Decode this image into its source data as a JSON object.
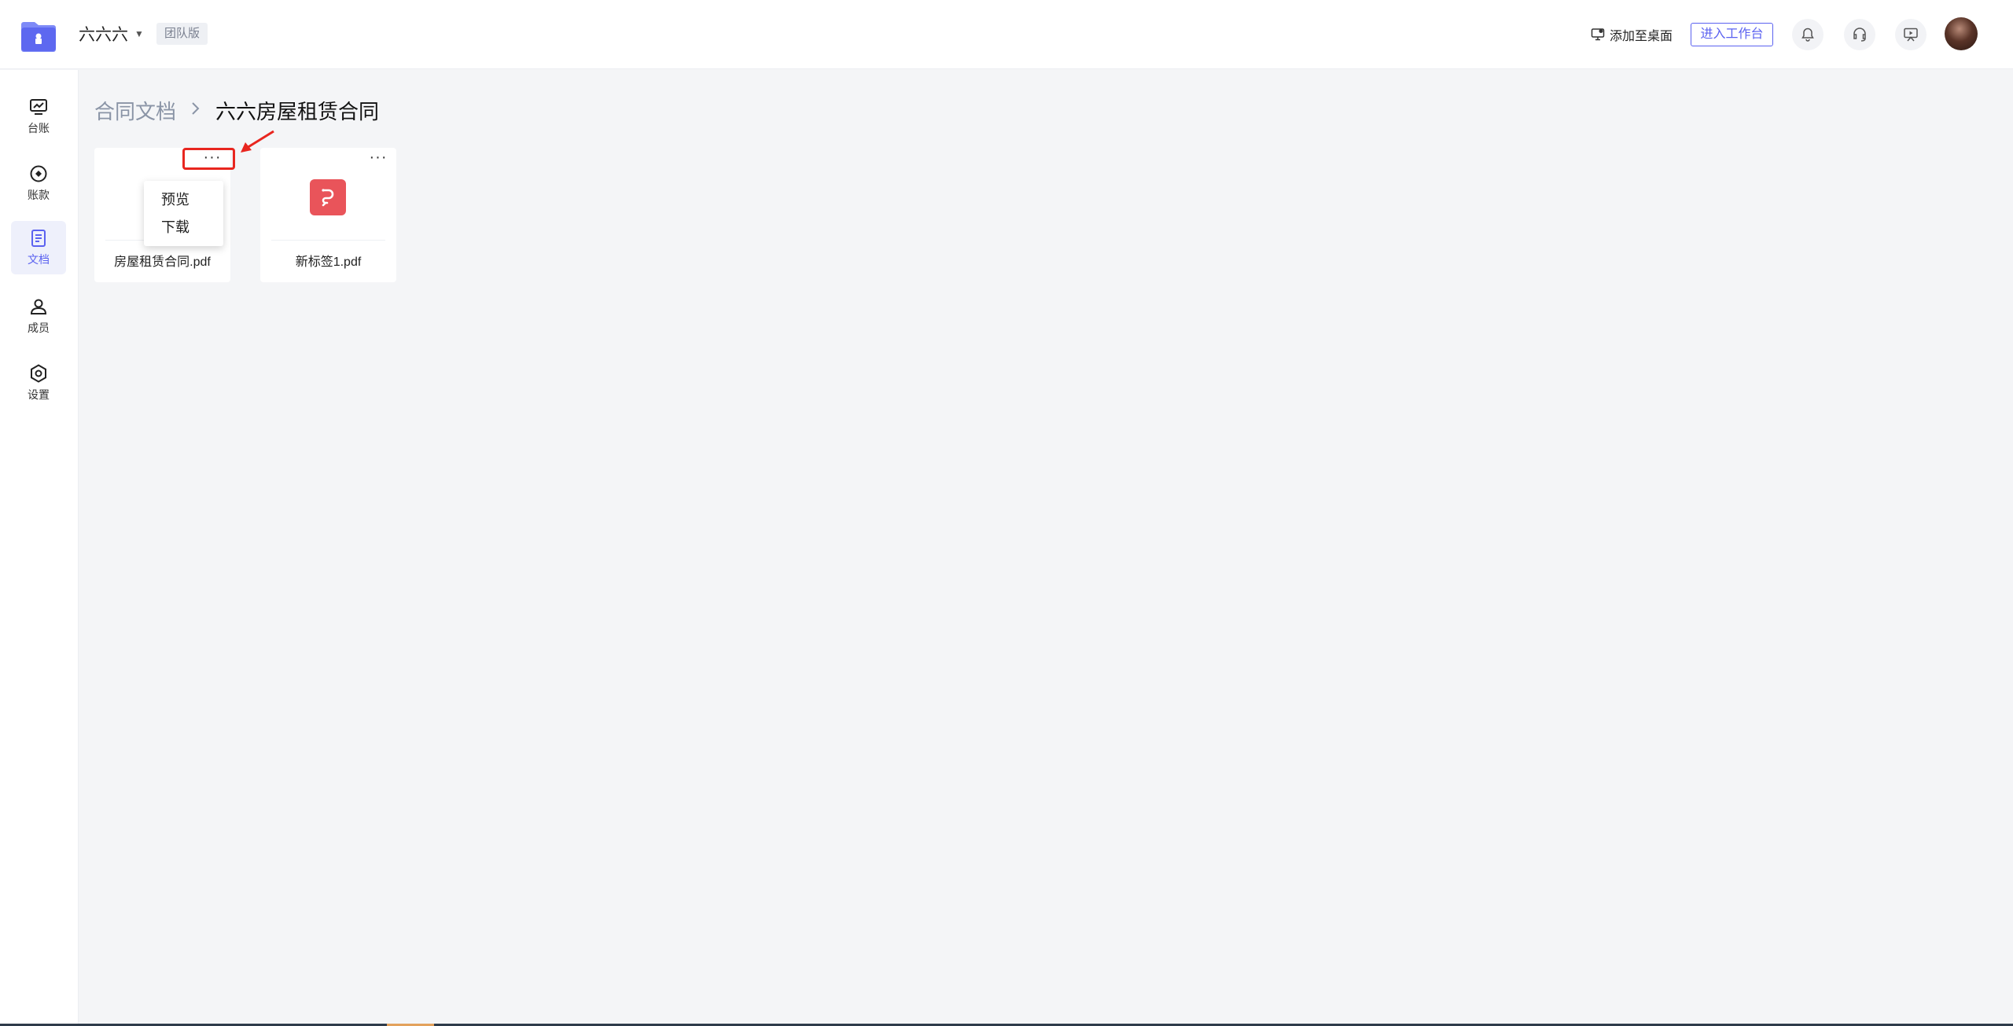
{
  "header": {
    "team_name": "六六六",
    "edition_badge": "团队版",
    "add_to_desktop": "添加至桌面",
    "enter_workbench": "进入工作台"
  },
  "sidebar": {
    "items": [
      {
        "label": "台账",
        "icon": "ledger-chart-icon",
        "active": false
      },
      {
        "label": "账款",
        "icon": "payment-circle-icon",
        "active": false
      },
      {
        "label": "文档",
        "icon": "document-icon",
        "active": true
      },
      {
        "label": "成员",
        "icon": "member-user-icon",
        "active": false
      },
      {
        "label": "设置",
        "icon": "settings-hexagon-icon",
        "active": false
      }
    ]
  },
  "breadcrumb": {
    "parent": "合同文档",
    "separator": ">",
    "current": "六六房屋租赁合同"
  },
  "files": [
    {
      "name": "房屋租赁合同.pdf",
      "more": "···"
    },
    {
      "name": "新标签1.pdf",
      "more": "···"
    }
  ],
  "dropdown": {
    "items": [
      "预览",
      "下载"
    ]
  },
  "colors": {
    "accent": "#5b62f0",
    "pdf_icon": "#e9545a",
    "highlight": "#e8261f",
    "background": "#f4f5f7"
  }
}
